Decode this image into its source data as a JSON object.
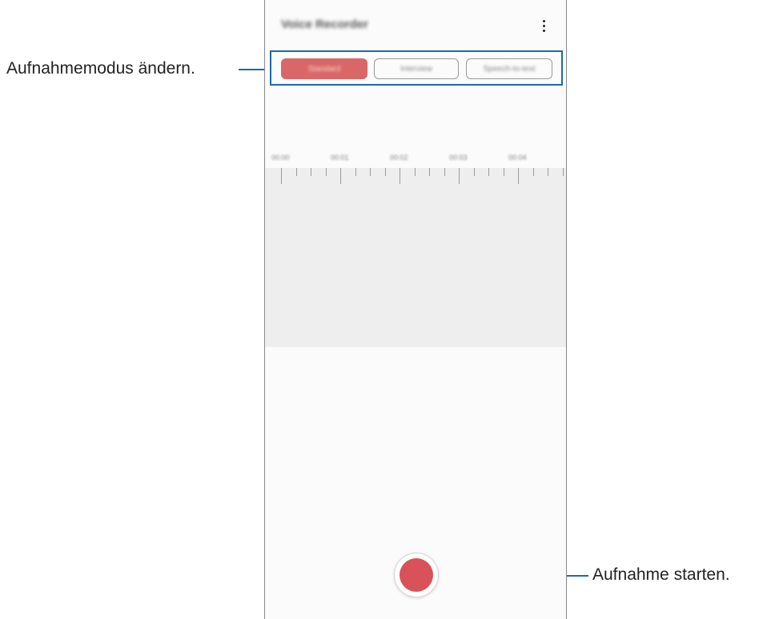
{
  "app": {
    "title": "Voice Recorder",
    "more_icon": "more-vertical-icon"
  },
  "modes": {
    "active": "Standard",
    "items": [
      "Standard",
      "Interview",
      "Speech-to-text"
    ]
  },
  "timeline": {
    "labels": [
      "00:00",
      "00:01",
      "00:02",
      "00:03",
      "00:04"
    ]
  },
  "record": {
    "icon": "record-icon",
    "color": "#d9525a"
  },
  "callouts": {
    "mode": "Aufnahmemodus ändern.",
    "record": "Aufnahme starten."
  },
  "colors": {
    "accent": "#1c6aa8",
    "active_tab": "#d96767"
  }
}
